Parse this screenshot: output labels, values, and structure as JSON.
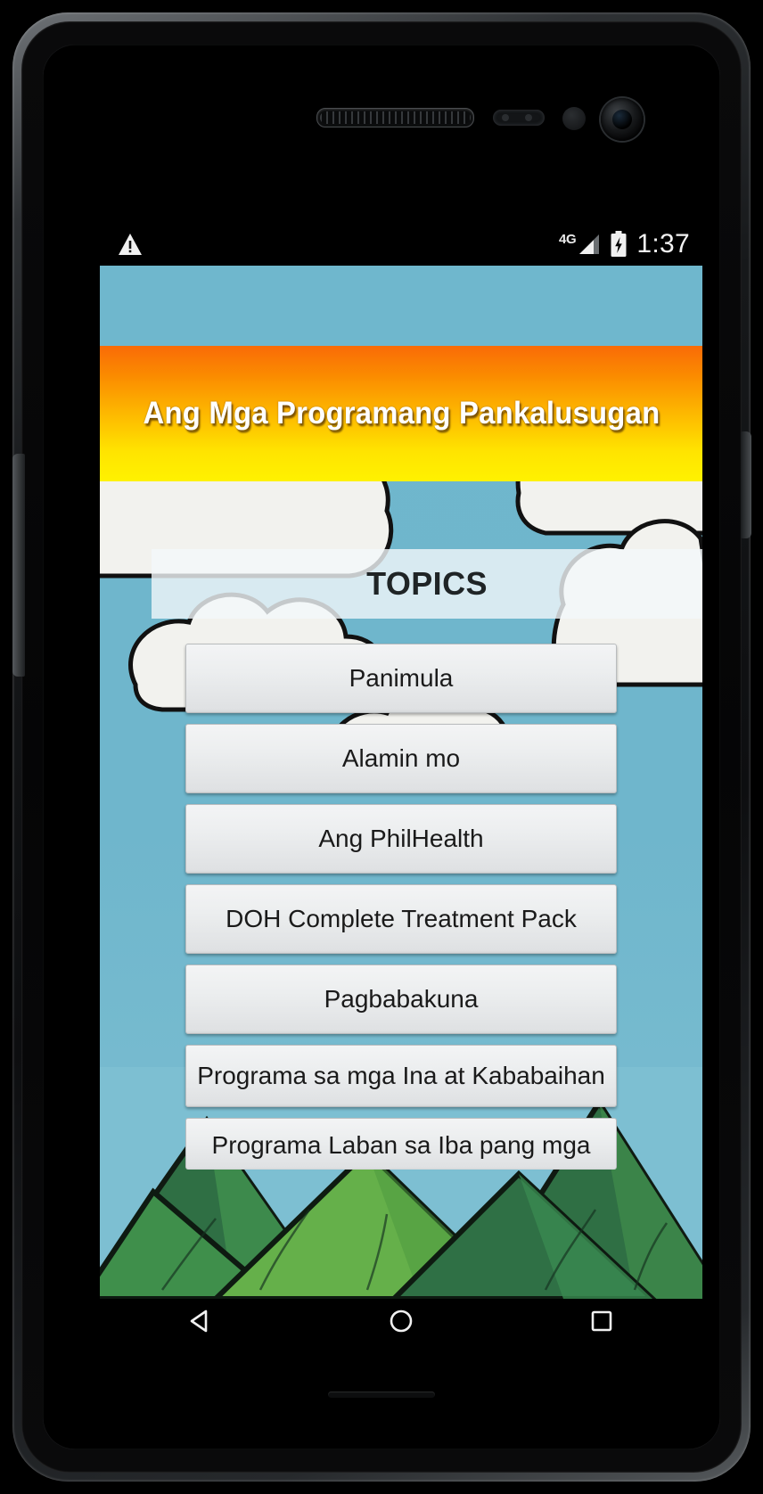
{
  "device": {
    "type": "android-phone",
    "hardware": {
      "earpiece": "earpiece-speaker",
      "proximity_sensor": "proximity-sensor",
      "front_camera": "front-camera"
    }
  },
  "status_bar": {
    "icons": [
      "warning-triangle-icon",
      "signal-4g-icon",
      "battery-charging-icon"
    ],
    "network_label": "4G",
    "time": "1:37"
  },
  "app": {
    "banner_title": "Ang Mga Programang Pankalusugan",
    "section_header": "TOPICS",
    "topics": [
      {
        "label": "Panimula"
      },
      {
        "label": "Alamin mo"
      },
      {
        "label": "Ang PhilHealth"
      },
      {
        "label": "DOH Complete Treatment Pack"
      },
      {
        "label": "Pagbabakuna"
      },
      {
        "label": "Programa sa mga Ina at Kababaihan"
      },
      {
        "label": "Programa Laban sa Iba pang mga"
      }
    ]
  },
  "nav_bar": {
    "back": "back-triangle-icon",
    "home": "home-circle-icon",
    "recents": "recents-square-icon"
  },
  "colors": {
    "banner_orange": "#f96b07",
    "banner_yellow": "#fff200",
    "sky_blue": "#6fb7cd",
    "hill_green": "#4f9b3f",
    "button_face": "#eceeef",
    "text_dark": "#1a1a1a"
  }
}
